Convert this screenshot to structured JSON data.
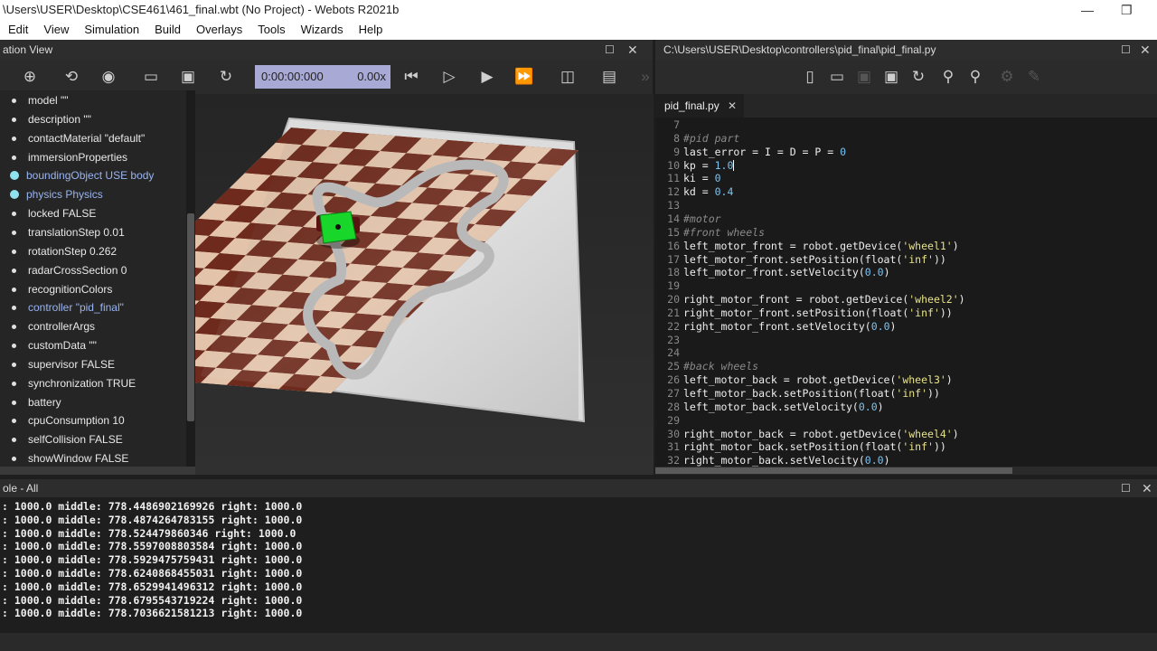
{
  "window": {
    "title": "\\Users\\USER\\Desktop\\CSE461\\461_final.wbt (No Project) - Webots R2021b",
    "minimize": "—",
    "restore": "❐"
  },
  "menu": [
    "Edit",
    "View",
    "Simulation",
    "Build",
    "Overlays",
    "Tools",
    "Wizards",
    "Help"
  ],
  "scene_panel": {
    "title": "ation View"
  },
  "sim_toolbar": {
    "time": "0:00:00:000",
    "speed": "0.00x"
  },
  "scene_tree": {
    "items": [
      {
        "label": "model \"\"",
        "style": "dot"
      },
      {
        "label": "description \"\"",
        "style": "dot"
      },
      {
        "label": "contactMaterial \"default\"",
        "style": "dot"
      },
      {
        "label": "immersionProperties",
        "style": "dot"
      },
      {
        "label": "boundingObject USE body",
        "style": "node"
      },
      {
        "label": "physics Physics",
        "style": "node"
      },
      {
        "label": "locked FALSE",
        "style": "dot"
      },
      {
        "label": "translationStep 0.01",
        "style": "dot"
      },
      {
        "label": "rotationStep 0.262",
        "style": "dot"
      },
      {
        "label": "radarCrossSection 0",
        "style": "dot"
      },
      {
        "label": "recognitionColors",
        "style": "dot"
      },
      {
        "label": "controller \"pid_final\"",
        "style": "dot-blue"
      },
      {
        "label": "controllerArgs",
        "style": "dot"
      },
      {
        "label": "customData \"\"",
        "style": "dot"
      },
      {
        "label": "supervisor FALSE",
        "style": "dot"
      },
      {
        "label": "synchronization TRUE",
        "style": "dot"
      },
      {
        "label": "battery",
        "style": "dot"
      },
      {
        "label": "cpuConsumption 10",
        "style": "dot"
      },
      {
        "label": "selfCollision FALSE",
        "style": "dot"
      },
      {
        "label": "showWindow FALSE",
        "style": "dot"
      }
    ]
  },
  "editor": {
    "title": "C:\\Users\\USER\\Desktop\\controllers\\pid_final\\pid_final.py",
    "tab": "pid_final.py"
  },
  "code_lines": [
    {
      "n": "7",
      "segs": []
    },
    {
      "n": "8",
      "segs": [
        {
          "t": "#pid part",
          "c": "cm"
        }
      ]
    },
    {
      "n": "9",
      "segs": [
        {
          "t": "last_error = I = D = P = ",
          "c": ""
        },
        {
          "t": "0",
          "c": "num"
        }
      ]
    },
    {
      "n": "10",
      "segs": [
        {
          "t": "kp = ",
          "c": ""
        },
        {
          "t": "1.0",
          "c": "num"
        },
        {
          "t": "",
          "c": "cursor"
        }
      ]
    },
    {
      "n": "11",
      "segs": [
        {
          "t": "ki = ",
          "c": ""
        },
        {
          "t": "0",
          "c": "num"
        }
      ]
    },
    {
      "n": "12",
      "segs": [
        {
          "t": "kd = ",
          "c": ""
        },
        {
          "t": "0.4",
          "c": "num"
        }
      ]
    },
    {
      "n": "13",
      "segs": []
    },
    {
      "n": "14",
      "segs": [
        {
          "t": "#motor",
          "c": "cm"
        }
      ]
    },
    {
      "n": "15",
      "segs": [
        {
          "t": "#front wheels",
          "c": "cm"
        }
      ]
    },
    {
      "n": "16",
      "segs": [
        {
          "t": "left_motor_front = robot.getDevice(",
          "c": ""
        },
        {
          "t": "'wheel1'",
          "c": "str"
        },
        {
          "t": ")",
          "c": ""
        }
      ]
    },
    {
      "n": "17",
      "segs": [
        {
          "t": "left_motor_front.setPosition(float(",
          "c": ""
        },
        {
          "t": "'inf'",
          "c": "str"
        },
        {
          "t": "))",
          "c": ""
        }
      ]
    },
    {
      "n": "18",
      "segs": [
        {
          "t": "left_motor_front.setVelocity(",
          "c": ""
        },
        {
          "t": "0.0",
          "c": "num"
        },
        {
          "t": ")",
          "c": ""
        }
      ]
    },
    {
      "n": "19",
      "segs": []
    },
    {
      "n": "20",
      "segs": [
        {
          "t": "right_motor_front = robot.getDevice(",
          "c": ""
        },
        {
          "t": "'wheel2'",
          "c": "str"
        },
        {
          "t": ")",
          "c": ""
        }
      ]
    },
    {
      "n": "21",
      "segs": [
        {
          "t": "right_motor_front.setPosition(float(",
          "c": ""
        },
        {
          "t": "'inf'",
          "c": "str"
        },
        {
          "t": "))",
          "c": ""
        }
      ]
    },
    {
      "n": "22",
      "segs": [
        {
          "t": "right_motor_front.setVelocity(",
          "c": ""
        },
        {
          "t": "0.0",
          "c": "num"
        },
        {
          "t": ")",
          "c": ""
        }
      ]
    },
    {
      "n": "23",
      "segs": []
    },
    {
      "n": "24",
      "segs": []
    },
    {
      "n": "25",
      "segs": [
        {
          "t": "#back wheels",
          "c": "cm"
        }
      ]
    },
    {
      "n": "26",
      "segs": [
        {
          "t": "left_motor_back = robot.getDevice(",
          "c": ""
        },
        {
          "t": "'wheel3'",
          "c": "str"
        },
        {
          "t": ")",
          "c": ""
        }
      ]
    },
    {
      "n": "27",
      "segs": [
        {
          "t": "left_motor_back.setPosition(float(",
          "c": ""
        },
        {
          "t": "'inf'",
          "c": "str"
        },
        {
          "t": "))",
          "c": ""
        }
      ]
    },
    {
      "n": "28",
      "segs": [
        {
          "t": "left_motor_back.setVelocity(",
          "c": ""
        },
        {
          "t": "0.0",
          "c": "num"
        },
        {
          "t": ")",
          "c": ""
        }
      ]
    },
    {
      "n": "29",
      "segs": []
    },
    {
      "n": "30",
      "segs": [
        {
          "t": "right_motor_back = robot.getDevice(",
          "c": ""
        },
        {
          "t": "'wheel4'",
          "c": "str"
        },
        {
          "t": ")",
          "c": ""
        }
      ]
    },
    {
      "n": "31",
      "segs": [
        {
          "t": "right_motor_back.setPosition(float(",
          "c": ""
        },
        {
          "t": "'inf'",
          "c": "str"
        },
        {
          "t": "))",
          "c": ""
        }
      ]
    },
    {
      "n": "32",
      "segs": [
        {
          "t": "right_motor_back.setVelocity(",
          "c": ""
        },
        {
          "t": "0.0",
          "c": "num"
        },
        {
          "t": ")",
          "c": ""
        }
      ]
    }
  ],
  "console": {
    "title": "ole - All",
    "lines": [
      ": 1000.0 middle: 778.4486902169926 right: 1000.0",
      ": 1000.0 middle: 778.4874264783155 right: 1000.0",
      ": 1000.0 middle: 778.524479860346 right: 1000.0",
      ": 1000.0 middle: 778.5597008803584 right: 1000.0",
      ": 1000.0 middle: 778.5929475759431 right: 1000.0",
      ": 1000.0 middle: 778.6240868455031 right: 1000.0",
      ": 1000.0 middle: 778.6529941496312 right: 1000.0",
      ": 1000.0 middle: 778.6795543719224 right: 1000.0",
      ": 1000.0 middle: 778.7036621581213 right: 1000.0"
    ]
  },
  "colors": {
    "checker_dark": "#6e2b1d",
    "checker_light": "#e3c4ab",
    "track": "#b9b9b9",
    "robot": "#19d62a",
    "time_box": "#a9a9d6"
  }
}
